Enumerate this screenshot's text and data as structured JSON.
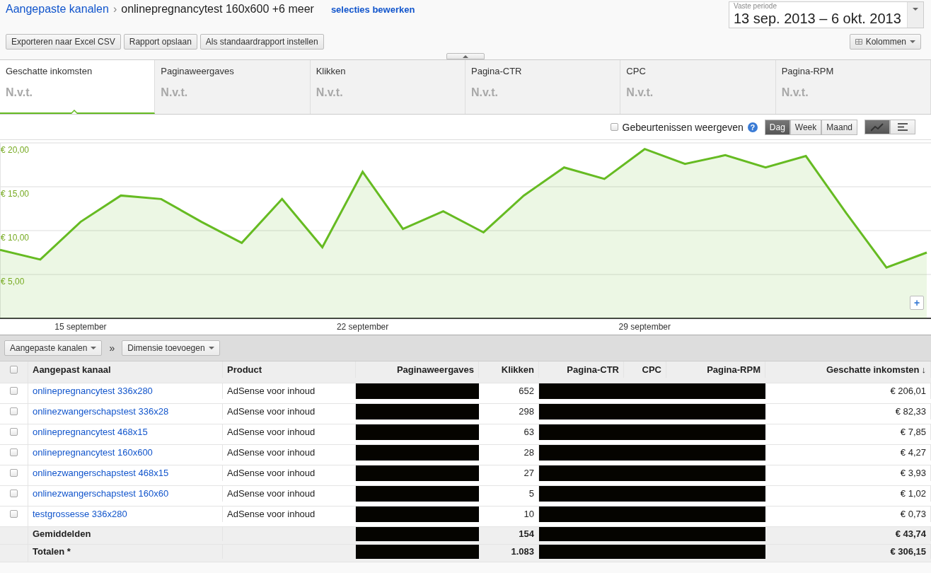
{
  "breadcrumb": {
    "parent": "Aangepaste kanalen",
    "separator": "›",
    "current": "onlinepregnancytest 160x600 +6 meer",
    "edit_link": "selecties bewerken"
  },
  "date_range": {
    "label": "Vaste periode",
    "value": "13 sep. 2013 – 6 okt. 2013"
  },
  "toolbar": {
    "buttons": [
      "Exporteren naar Excel CSV",
      "Rapport opslaan",
      "Als standaardrapport instellen"
    ],
    "columns_button": "Kolommen"
  },
  "metric_tabs": [
    {
      "label": "Geschatte inkomsten",
      "value": "N.v.t.",
      "selected": true
    },
    {
      "label": "Paginaweergaves",
      "value": "N.v.t.",
      "selected": false
    },
    {
      "label": "Klikken",
      "value": "N.v.t.",
      "selected": false
    },
    {
      "label": "Pagina-CTR",
      "value": "N.v.t.",
      "selected": false
    },
    {
      "label": "CPC",
      "value": "N.v.t.",
      "selected": false
    },
    {
      "label": "Pagina-RPM",
      "value": "N.v.t.",
      "selected": false
    }
  ],
  "chart_controls": {
    "events": {
      "label": "Gebeurtenissen weergeven",
      "checked": false,
      "help": "?"
    },
    "periods": [
      {
        "label": "Dag",
        "selected": true
      },
      {
        "label": "Week",
        "selected": false
      },
      {
        "label": "Maand",
        "selected": false
      }
    ],
    "views": [
      {
        "kind": "line",
        "selected": true
      },
      {
        "kind": "bar",
        "selected": false
      }
    ],
    "zoom_button": "+"
  },
  "chart": {
    "chart_data": {
      "type": "area",
      "categories": [
        null,
        null,
        "15 september",
        null,
        null,
        null,
        null,
        null,
        null,
        "22 september",
        null,
        null,
        null,
        null,
        null,
        null,
        "29 september",
        null,
        null,
        null,
        null,
        null,
        null,
        null
      ],
      "series": [
        {
          "color": "#66bb22",
          "values": [
            7.8,
            6.7,
            11.0,
            14.0,
            13.6,
            11.0,
            8.6,
            13.6,
            8.1,
            16.7,
            10.2,
            12.2,
            9.8,
            14.0,
            17.2,
            15.9,
            19.3,
            17.6,
            18.6,
            17.2,
            18.5,
            12.0,
            5.8,
            7.5
          ]
        }
      ],
      "ylim": [
        0,
        20
      ],
      "grid": true,
      "yticks": [
        {
          "value": 5,
          "label": "€ 5,00"
        },
        {
          "value": 10,
          "label": "€ 10,00"
        },
        {
          "value": 15,
          "label": "€ 15,00"
        },
        {
          "value": 20,
          "label": "€ 20,00"
        }
      ]
    }
  },
  "dimension_bar": {
    "dimension": "Aangepaste kanalen",
    "separator": "»",
    "add": "Dimensie toevoegen"
  },
  "table": {
    "header_checked": false,
    "columns": [
      {
        "label": "Aangepast kanaal"
      },
      {
        "label": "Product"
      },
      {
        "label": "Paginaweergaves"
      },
      {
        "label": "Klikken"
      },
      {
        "label": "Pagina-CTR"
      },
      {
        "label": "CPC"
      },
      {
        "label": "Pagina-RPM"
      },
      {
        "label": "Geschatte inkomsten",
        "sort_arrow": "↓"
      }
    ],
    "rows": [
      {
        "checked": false,
        "channel": "onlinepregnancytest 336x280",
        "product": "AdSense voor inhoud",
        "clicks": "652",
        "income": "€ 206,01"
      },
      {
        "checked": false,
        "channel": "onlinezwangerschapstest 336x28",
        "product": "AdSense voor inhoud",
        "clicks": "298",
        "income": "€ 82,33"
      },
      {
        "checked": false,
        "channel": "onlinepregnancytest 468x15",
        "product": "AdSense voor inhoud",
        "clicks": "63",
        "income": "€ 7,85"
      },
      {
        "checked": false,
        "channel": "onlinepregnancytest 160x600",
        "product": "AdSense voor inhoud",
        "clicks": "28",
        "income": "€ 4,27"
      },
      {
        "checked": false,
        "channel": "onlinezwangerschapstest 468x15",
        "product": "AdSense voor inhoud",
        "clicks": "27",
        "income": "€ 3,93"
      },
      {
        "checked": false,
        "channel": "onlinezwangerschapstest 160x60",
        "product": "AdSense voor inhoud",
        "clicks": "5",
        "income": "€ 1,02"
      },
      {
        "checked": false,
        "channel": "testgrossesse 336x280",
        "product": "AdSense voor inhoud",
        "clicks": "10",
        "income": "€ 0,73"
      }
    ],
    "summary": [
      {
        "label": "Gemiddelden",
        "clicks": "154",
        "income": "€ 43,74"
      },
      {
        "label": "Totalen *",
        "clicks": "1.083",
        "income": "€ 306,15"
      }
    ]
  }
}
